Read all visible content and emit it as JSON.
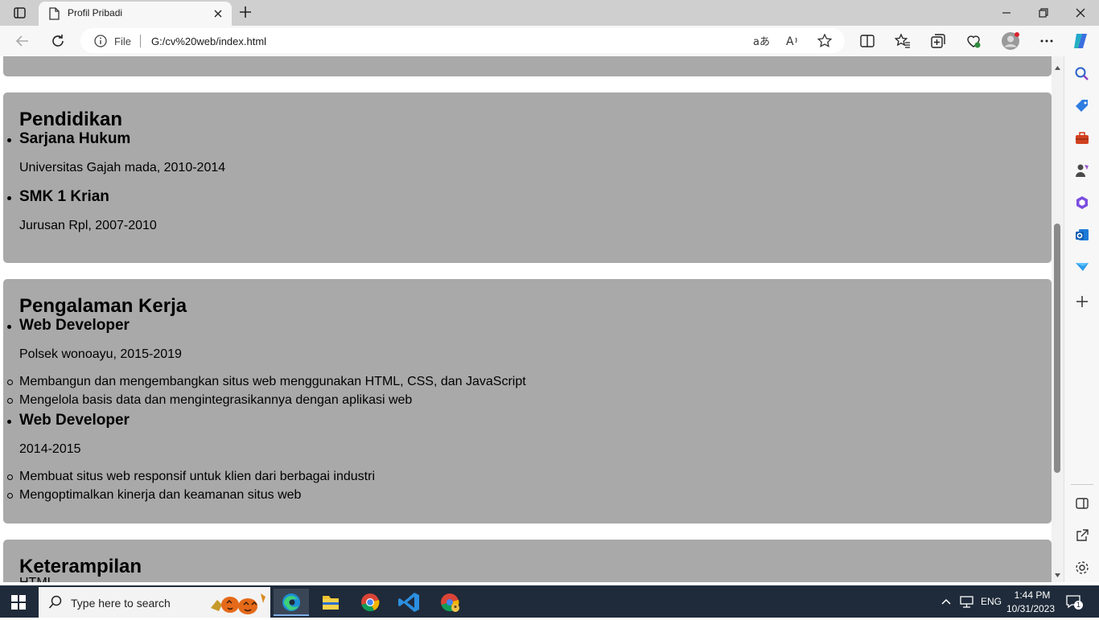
{
  "browser": {
    "tab_title": "Profil Pribadi",
    "address_scheme": "File",
    "address_url": "G:/cv%20web/index.html",
    "notification_count": "1"
  },
  "page": {
    "pendidikan": {
      "heading": "Pendidikan",
      "items": [
        {
          "title": "Sarjana Hukum",
          "detail": "Universitas Gajah mada, 2010-2014"
        },
        {
          "title": "SMK 1 Krian",
          "detail": "Jurusan Rpl, 2007-2010"
        }
      ]
    },
    "pengalaman": {
      "heading": "Pengalaman Kerja",
      "jobs": [
        {
          "title": "Web Developer",
          "detail": "Polsek wonoayu, 2015-2019",
          "tasks": [
            "Membangun dan mengembangkan situs web menggunakan HTML, CSS, dan JavaScript",
            "Mengelola basis data dan mengintegrasikannya dengan aplikasi web"
          ]
        },
        {
          "title": "Web Developer",
          "detail": "2014-2015",
          "tasks": [
            "Membuat situs web responsif untuk klien dari berbagai industri",
            "Mengoptimalkan kinerja dan keamanan situs web"
          ]
        }
      ]
    },
    "keterampilan": {
      "heading": "Keterampilan",
      "first_item": "HTML"
    }
  },
  "taskbar": {
    "search_placeholder": "Type here to search",
    "language": "ENG",
    "time": "1:44 PM",
    "date": "10/31/2023"
  },
  "colors": {
    "section_bg": "#a9a9a9",
    "taskbar_bg": "#1f2b3a",
    "chrome_bg": "#f7f7f7"
  }
}
